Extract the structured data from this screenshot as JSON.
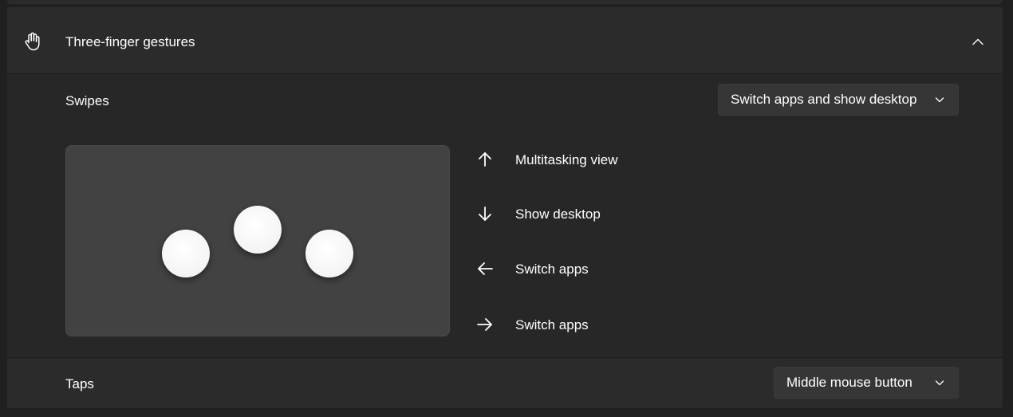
{
  "gesture_card": {
    "title": "Three-finger gestures",
    "header_icon": "hand-icon",
    "expanded": true
  },
  "swipes": {
    "label": "Swipes",
    "dropdown_value": "Switch apps and show desktop",
    "actions": [
      {
        "direction": "up",
        "icon": "arrow-up-icon",
        "label": "Multitasking view"
      },
      {
        "direction": "down",
        "icon": "arrow-down-icon",
        "label": "Show desktop"
      },
      {
        "direction": "left",
        "icon": "arrow-left-icon",
        "label": "Switch apps"
      },
      {
        "direction": "right",
        "icon": "arrow-right-icon",
        "label": "Switch apps"
      }
    ]
  },
  "taps": {
    "label": "Taps",
    "dropdown_value": "Middle mouse button"
  },
  "colors": {
    "background": "#202020",
    "card": "#272727",
    "header": "#2b2b2b",
    "dropdown": "#363636",
    "preview": "#424242",
    "finger": "#ffffff"
  }
}
